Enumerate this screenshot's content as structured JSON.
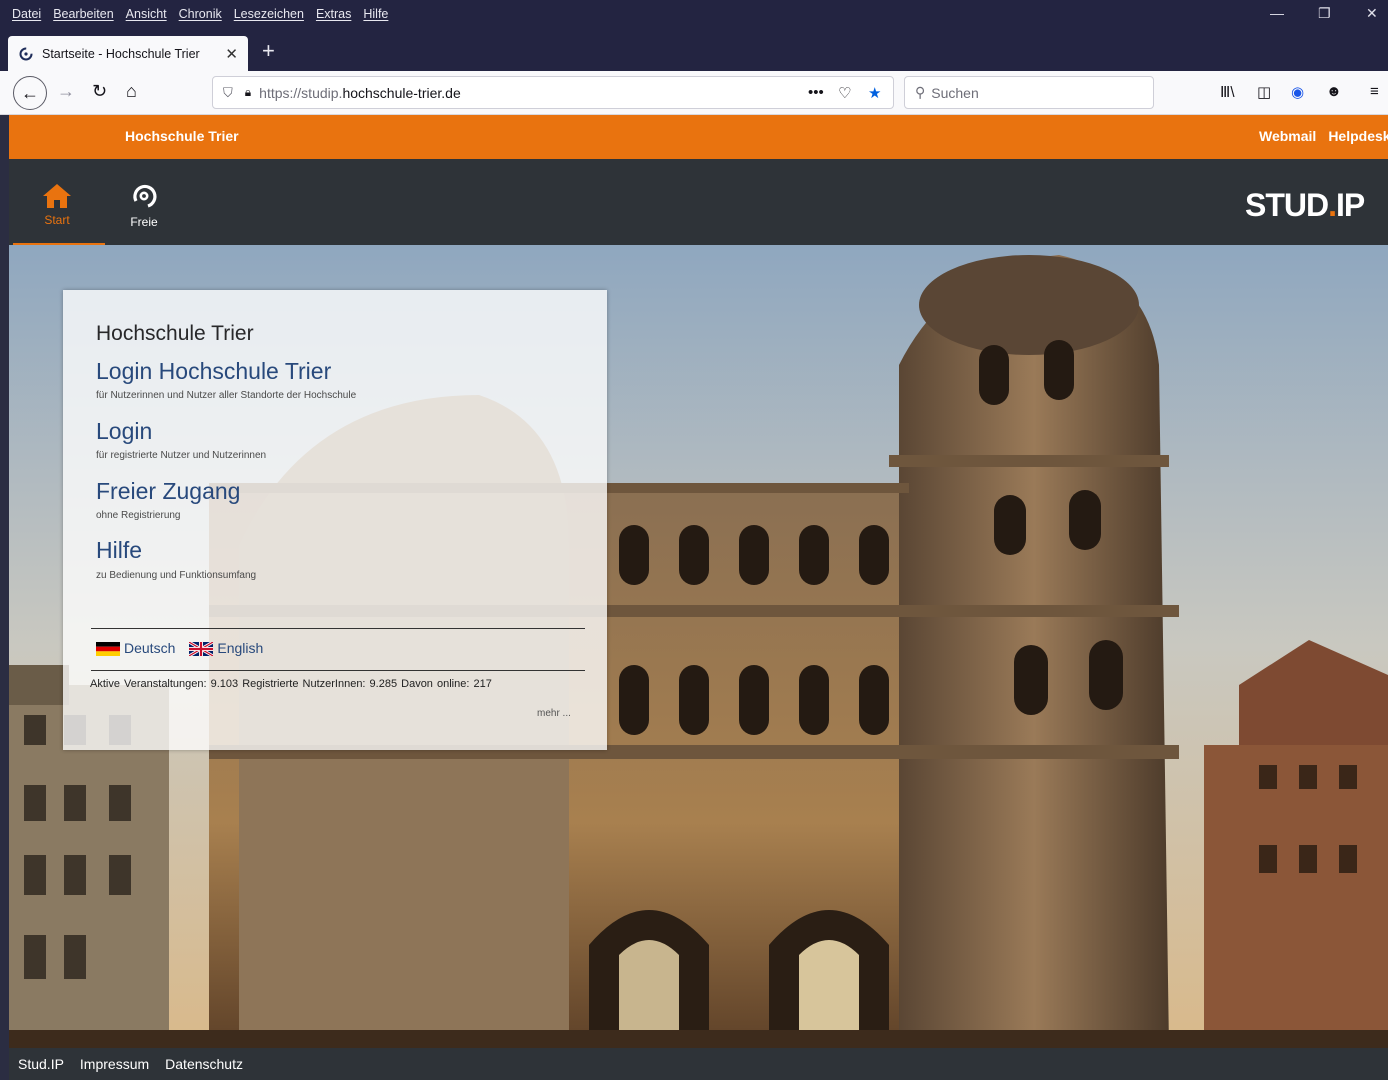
{
  "browser": {
    "menu": [
      "Datei",
      "Bearbeiten",
      "Ansicht",
      "Chronik",
      "Lesezeichen",
      "Extras",
      "Hilfe"
    ],
    "tab_title": "Startseite - Hochschule Trier",
    "url_prefix": "https://studip.",
    "url_host": "hochschule-trier.de",
    "search_placeholder": "Suchen"
  },
  "site": {
    "title": "Hochschule Trier",
    "top_links": [
      "Webmail",
      "Helpdesk"
    ],
    "nav": [
      {
        "label": "Start",
        "icon": "home-icon",
        "active": true
      },
      {
        "label": "Freie",
        "icon": "studip-free-icon",
        "active": false
      }
    ],
    "logo": {
      "part1": "STUD",
      "dot": ".",
      "part2": "IP"
    },
    "colors": {
      "accent": "#e9730f",
      "dark": "#2e3338",
      "link": "#28497c"
    }
  },
  "login_box": {
    "heading": "Hochschule Trier",
    "links": [
      {
        "label": "Login Hochschule Trier",
        "sub": "für Nutzerinnen und Nutzer aller Standorte der Hochschule"
      },
      {
        "label": "Login",
        "sub": "für registrierte Nutzer und Nutzerinnen"
      },
      {
        "label": "Freier Zugang",
        "sub": "ohne Registrierung"
      },
      {
        "label": "Hilfe",
        "sub": "zu Bedienung und Funktionsumfang"
      }
    ],
    "languages": [
      "Deutsch",
      "English"
    ],
    "stats": "Aktive Veranstaltungen: 9.103   Registrierte NutzerInnen: 9.285   Davon online: 217",
    "more": "mehr ..."
  },
  "footer": [
    "Stud.IP",
    "Impressum",
    "Datenschutz"
  ]
}
